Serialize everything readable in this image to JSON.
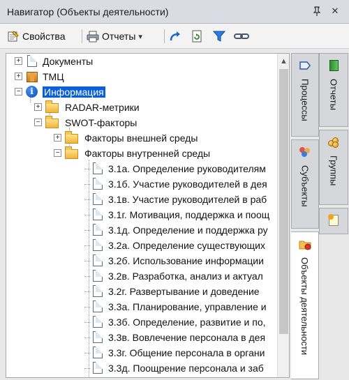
{
  "window": {
    "title": "Навигатор (Объекты деятельности)",
    "pin_glyph": "ᵖ",
    "close_glyph": "✕"
  },
  "toolbar": {
    "properties_label": "Свойства",
    "reports_label": "Отчеты",
    "reports_arrow": "▾"
  },
  "tree": {
    "rows": [
      {
        "label": "Документы",
        "icon": "document-icon",
        "expander": "+"
      },
      {
        "label": "ТМЦ",
        "icon": "box-icon",
        "expander": "+"
      },
      {
        "label": "Информация",
        "icon": "info-icon",
        "expander": "−",
        "selected": true
      },
      {
        "label": "RADAR-метрики",
        "icon": "folder-icon",
        "expander": "+"
      },
      {
        "label": "SWOT-факторы",
        "icon": "folder-icon",
        "expander": "−"
      },
      {
        "label": "Факторы внешней среды",
        "icon": "folder-icon",
        "expander": "+"
      },
      {
        "label": "Факторы внутренней среды",
        "icon": "folder-icon",
        "expander": "−"
      },
      {
        "label": "3.1а. Определение руководителям",
        "icon": "document-icon"
      },
      {
        "label": "3.1б. Участие руководителей в дея",
        "icon": "document-icon"
      },
      {
        "label": "3.1в. Участие руководителей в раб",
        "icon": "document-icon"
      },
      {
        "label": "3.1г. Мотивация, поддержка и поощ",
        "icon": "document-icon"
      },
      {
        "label": "3.1д. Определение и поддержка ру",
        "icon": "document-icon"
      },
      {
        "label": "3.2а. Определение существующих",
        "icon": "document-icon"
      },
      {
        "label": "3.2б. Использование информации",
        "icon": "document-icon"
      },
      {
        "label": "3.2в. Разработка, анализ и актуал",
        "icon": "document-icon"
      },
      {
        "label": "3.2г. Развертывание и доведение",
        "icon": "document-icon"
      },
      {
        "label": "3.3а. Планирование, управление и",
        "icon": "document-icon"
      },
      {
        "label": "3.3б. Определение, развитие и по,",
        "icon": "document-icon"
      },
      {
        "label": "3.3в. Вовлечение персонала в дея",
        "icon": "document-icon"
      },
      {
        "label": "3.3г. Общение персонала в органи",
        "icon": "document-icon"
      },
      {
        "label": "3.3д. Поощрение персонала и заб",
        "icon": "document-icon"
      }
    ]
  },
  "scrollbar": {
    "up_arrow": "▲"
  },
  "side_tabs_left": [
    {
      "label": "Процессы",
      "icon": "processes-icon"
    },
    {
      "label": "Субъекты",
      "icon": "people-icon"
    },
    {
      "label": "Объекты деятельности",
      "icon": "objects-icon",
      "active": true
    }
  ],
  "side_tabs_right": [
    {
      "label": "Отчеты",
      "icon": "green-book-icon"
    },
    {
      "label": "Группы",
      "icon": "coins-icon"
    },
    {
      "label": "",
      "icon": "note-icon"
    }
  ]
}
